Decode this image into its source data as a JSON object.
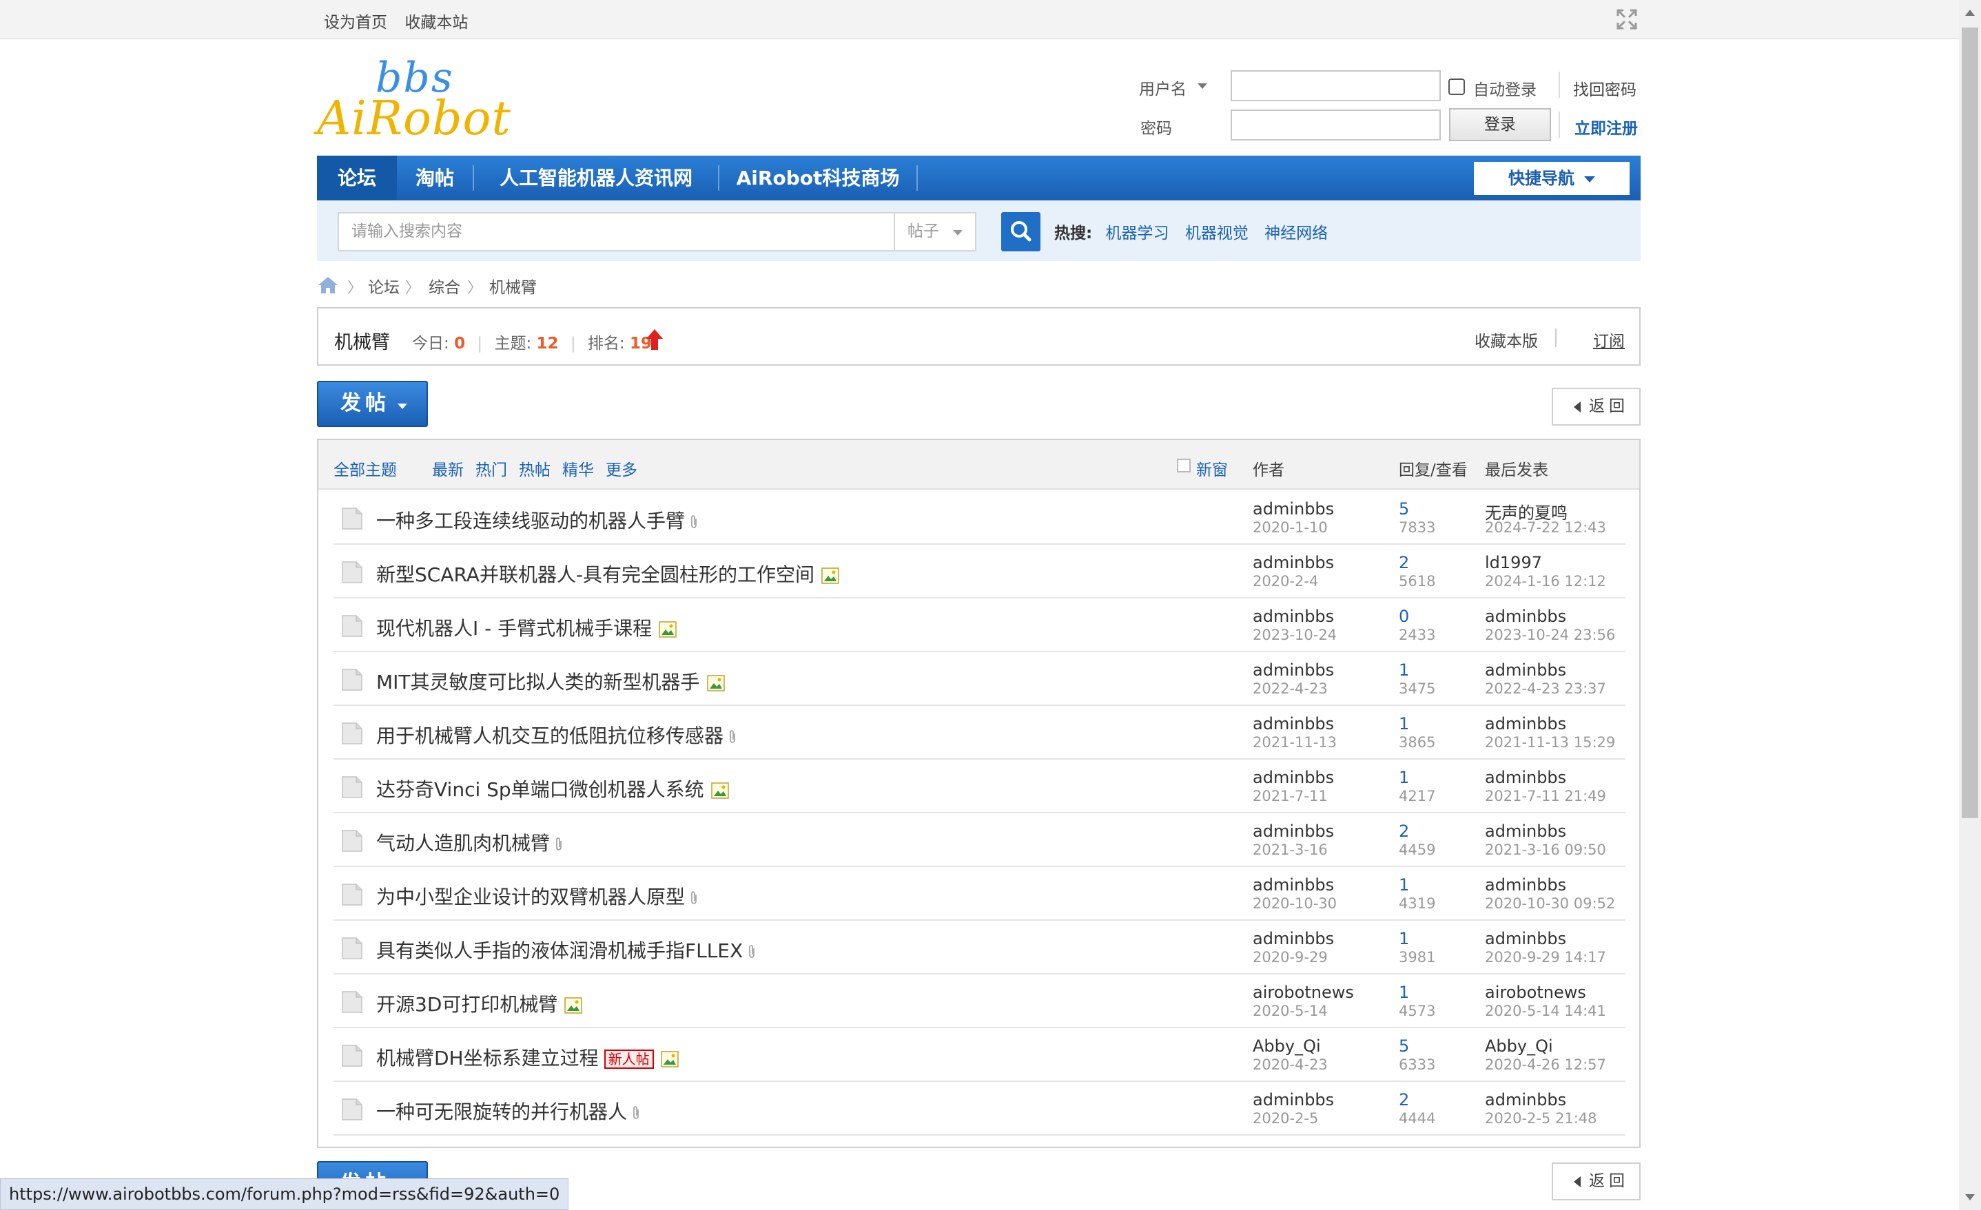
{
  "topbar": {
    "set_home": "设为首页",
    "favorite_site": "收藏本站"
  },
  "logo": {
    "line1": "bbs",
    "line2": "AiRobot"
  },
  "login": {
    "username_label": "用户名",
    "password_label": "密码",
    "auto_login": "自动登录",
    "login_button": "登录",
    "retrieve_password": "找回密码",
    "register": "立即注册"
  },
  "nav": {
    "items": [
      "论坛",
      "淘帖",
      "人工智能机器人资讯网",
      "AiRobot科技商场"
    ],
    "quick_nav": "快捷导航"
  },
  "search": {
    "placeholder": "请输入搜索内容",
    "type": "帖子",
    "hot_label": "热搜:",
    "hot_keywords": [
      "机器学习",
      "机器视觉",
      "神经网络"
    ]
  },
  "breadcrumb": [
    "论坛",
    "综合",
    "机械臂"
  ],
  "forum": {
    "name": "机械臂",
    "today_label": "今日:",
    "today": "0",
    "topics_label": "主题:",
    "topics": "12",
    "rank_label": "排名:",
    "rank": "19",
    "favorite": "收藏本版",
    "subscribe": "订阅"
  },
  "actions": {
    "post": "发帖",
    "back": "返回"
  },
  "list_header": {
    "all": "全部主题",
    "filters": [
      "最新",
      "热门",
      "热帖",
      "精华",
      "更多"
    ],
    "new_window": "新窗",
    "author": "作者",
    "reply_view": "回复/查看",
    "last_post": "最后发表"
  },
  "threads": [
    {
      "title": "一种多工段连续线驱动的机器人手臂",
      "attach": "clip",
      "author": "adminbbs",
      "date": "2020-1-10",
      "replies": "5",
      "views": "7833",
      "last_user": "无声的夏鸣",
      "last_date": "2024-7-22 12:43"
    },
    {
      "title": "新型SCARA并联机器人-具有完全圆柱形的工作空间",
      "attach": "image",
      "author": "adminbbs",
      "date": "2020-2-4",
      "replies": "2",
      "views": "5618",
      "last_user": "ld1997",
      "last_date": "2024-1-16 12:12"
    },
    {
      "title": "现代机器人I - 手臂式机械手课程",
      "attach": "image",
      "author": "adminbbs",
      "date": "2023-10-24",
      "replies": "0",
      "views": "2433",
      "last_user": "adminbbs",
      "last_date": "2023-10-24 23:56"
    },
    {
      "title": "MIT其灵敏度可比拟人类的新型机器手",
      "attach": "image",
      "author": "adminbbs",
      "date": "2022-4-23",
      "replies": "1",
      "views": "3475",
      "last_user": "adminbbs",
      "last_date": "2022-4-23 23:37"
    },
    {
      "title": "用于机械臂人机交互的低阻抗位移传感器",
      "attach": "clip",
      "author": "adminbbs",
      "date": "2021-11-13",
      "replies": "1",
      "views": "3865",
      "last_user": "adminbbs",
      "last_date": "2021-11-13 15:29"
    },
    {
      "title": "达芬奇Vinci Sp单端口微创机器人系统",
      "attach": "image",
      "author": "adminbbs",
      "date": "2021-7-11",
      "replies": "1",
      "views": "4217",
      "last_user": "adminbbs",
      "last_date": "2021-7-11 21:49"
    },
    {
      "title": "气动人造肌肉机械臂",
      "attach": "clip",
      "author": "adminbbs",
      "date": "2021-3-16",
      "replies": "2",
      "views": "4459",
      "last_user": "adminbbs",
      "last_date": "2021-3-16 09:50"
    },
    {
      "title": "为中小型企业设计的双臂机器人原型",
      "attach": "clip",
      "author": "adminbbs",
      "date": "2020-10-30",
      "replies": "1",
      "views": "4319",
      "last_user": "adminbbs",
      "last_date": "2020-10-30 09:52"
    },
    {
      "title": "具有类似人手指的液体润滑机械手指FLLEX",
      "attach": "clip",
      "author": "adminbbs",
      "date": "2020-9-29",
      "replies": "1",
      "views": "3981",
      "last_user": "adminbbs",
      "last_date": "2020-9-29 14:17"
    },
    {
      "title": "开源3D可打印机械臂",
      "attach": "image",
      "author": "airobotnews",
      "date": "2020-5-14",
      "replies": "1",
      "views": "4573",
      "last_user": "airobotnews",
      "last_date": "2020-5-14 14:41"
    },
    {
      "title": "机械臂DH坐标系建立过程",
      "attach": "image",
      "badge": "新人帖",
      "author": "Abby_Qi",
      "date": "2020-4-23",
      "replies": "5",
      "views": "6333",
      "last_user": "Abby_Qi",
      "last_date": "2020-4-26 12:57"
    },
    {
      "title": "一种可无限旋转的并行机器人",
      "attach": "clip",
      "author": "adminbbs",
      "date": "2020-2-5",
      "replies": "2",
      "views": "4444",
      "last_user": "adminbbs",
      "last_date": "2020-2-5 21:48"
    }
  ],
  "statusbar": "https://www.airobotbbs.com/forum.php?mod=rss&fid=92&auth=0",
  "colors": {
    "accent": "#1a5fb4",
    "link": "#1a62b5",
    "highlight": "#f05a28",
    "logo_blue": "#3a8ee6",
    "logo_yellow": "#f0b400"
  }
}
